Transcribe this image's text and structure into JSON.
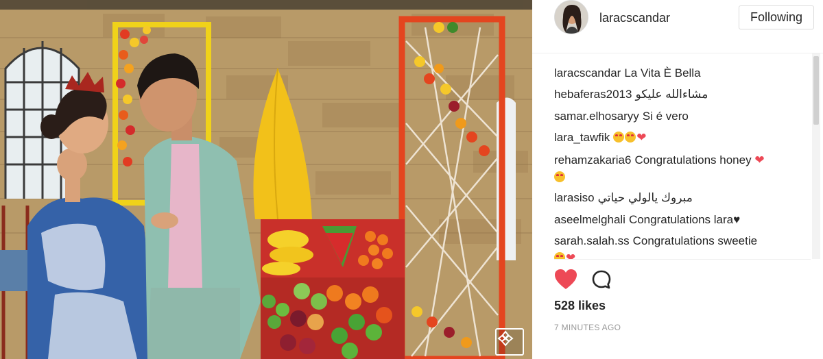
{
  "post": {
    "username": "laracscandar",
    "follow_label": "Following",
    "likes_label": "528 likes",
    "timestamp": "7 MINUTES AGO"
  },
  "comments": [
    {
      "user": "laracscandar",
      "text": "La Vita È Bella"
    },
    {
      "user": "hebaferas2013",
      "text": "مشاءالله عليكو"
    },
    {
      "user": "samar.elhosaryy",
      "text": "Si é vero"
    },
    {
      "user": "lara_tawfik",
      "text": ""
    },
    {
      "user": "rehamzakaria6",
      "text": "Congratulations honey"
    },
    {
      "user": "larasiso",
      "text": "مبروك يالولي حياتي"
    },
    {
      "user": "aseelmelghali",
      "text": "Congratulations lara"
    },
    {
      "user": "sarah.salah.ss",
      "text": "Congratulations sweetie"
    }
  ],
  "icons": {
    "like": "heart-icon",
    "comment": "comment-bubble-icon",
    "slideshow": "slideshow-icon"
  },
  "colors": {
    "like_red": "#ed4956",
    "text": "#262626",
    "muted": "#999999",
    "border": "#dbdbdb"
  }
}
